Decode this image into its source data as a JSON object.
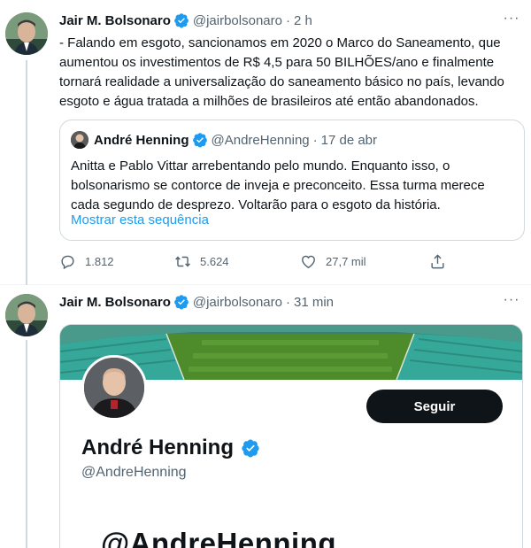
{
  "tweets": [
    {
      "author": {
        "name": "Jair M. Bolsonaro",
        "handle": "@jairbolsonaro",
        "time": "2 h"
      },
      "text": "- Falando em esgoto, sancionamos em 2020 o Marco do Saneamento, que aumentou os investimentos de R$ 4,5 para 50 BILHÕES/ano e finalmente tornará realidade a universalização do saneamento básico no país, levando esgoto e água tratada a milhões de brasileiros até então abandonados.",
      "quote": {
        "name": "André Henning",
        "handle": "@AndreHenning",
        "date": "17 de abr",
        "text": "Anitta e Pablo Vittar arrebentando pelo mundo. Enquanto isso, o bolsonarismo se contorce de inveja e preconceito. Essa turma merece cada segundo de desprezo. Voltarão para o esgoto da história.",
        "show_thread": "Mostrar esta sequência"
      },
      "stats": {
        "replies": "1.812",
        "retweets": "5.624",
        "likes": "27,7 mil"
      }
    },
    {
      "author": {
        "name": "Jair M. Bolsonaro",
        "handle": "@jairbolsonaro",
        "time": "31 min"
      },
      "card": {
        "name": "André Henning",
        "handle": "@AndreHenning",
        "follow_label": "Seguir",
        "big_handle": "@AndreHenning"
      }
    }
  ],
  "separator": "·",
  "more_icon": "···",
  "colors": {
    "verified": "#1d9bf0",
    "link": "#1d9bf0",
    "secondary_text": "#536471",
    "border": "#cfd9de",
    "follow_button": "#0f1419"
  },
  "icons": {
    "reply": "reply-icon",
    "retweet": "retweet-icon",
    "like": "heart-icon",
    "share": "share-icon",
    "verified": "verified-badge-icon",
    "more": "more-options-icon"
  }
}
